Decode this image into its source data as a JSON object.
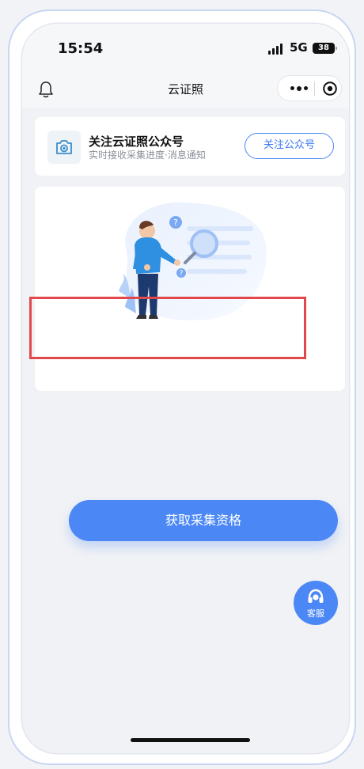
{
  "status_bar": {
    "time": "15:54",
    "network": "5G",
    "battery": "38"
  },
  "nav": {
    "title": "云证照",
    "bell_icon": "bell-icon",
    "more_icon": "more-dots-icon",
    "close_icon": "target-circle-icon"
  },
  "follow_card": {
    "icon": "camera-icon",
    "title": "关注云证照公众号",
    "subtitle": "实时接收采集进度·消息通知",
    "button_label": "关注公众号"
  },
  "main_card": {
    "illustration": "person-with-magnifier-illustration",
    "apply_button_label": "获取采集资格"
  },
  "service": {
    "label": "客服",
    "icon": "headset-icon"
  },
  "colors": {
    "accent": "#4b88f6",
    "highlight": "#e2474b",
    "background": "#f1f2f5"
  }
}
